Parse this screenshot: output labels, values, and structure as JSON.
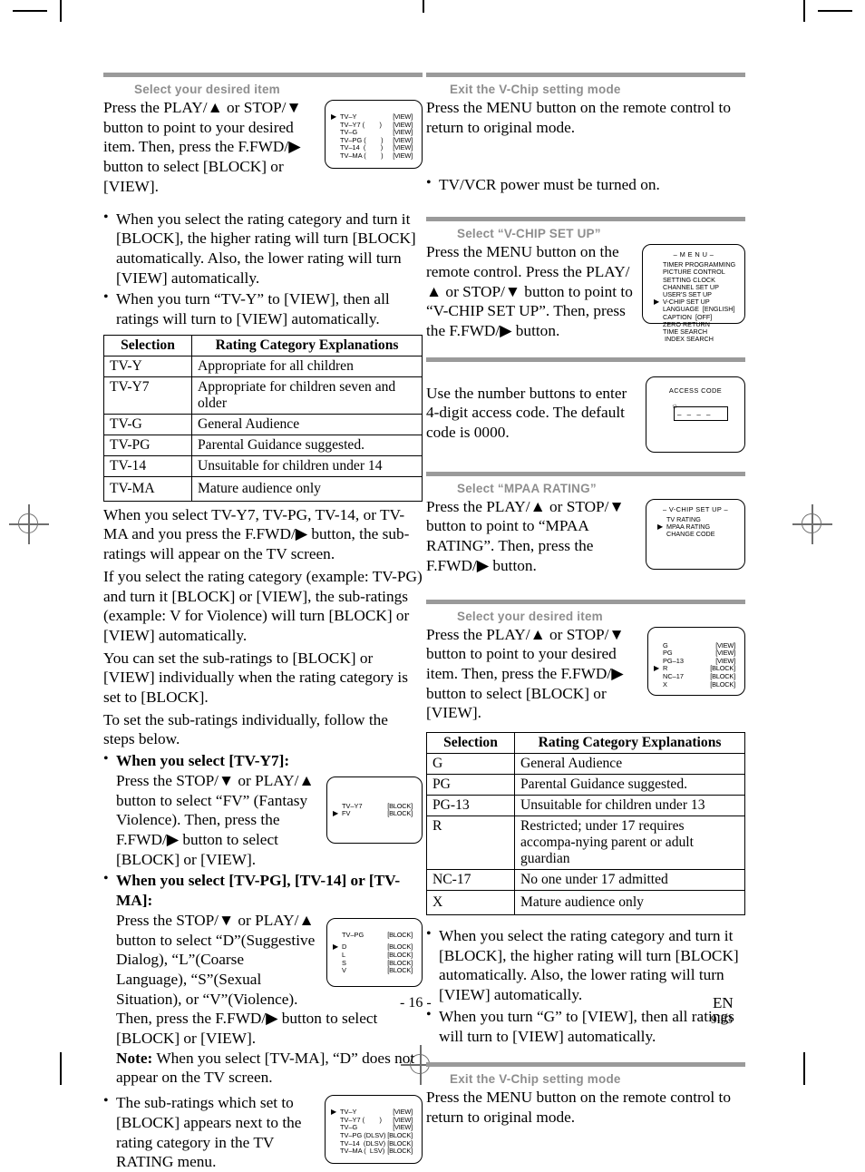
{
  "page": {
    "number_label": "- 16 -",
    "lang_code": "EN",
    "doc_code": "9I03"
  },
  "left_column": {
    "section1": {
      "title": "Select your desired item",
      "paragraph": "Press the PLAY/▲ or STOP/▼ button to point to your desired item. Then, press the F.FWD/▶ button to select [BLOCK] or [VIEW].",
      "osd": {
        "name": "tv-rating-screen",
        "cursor_index": 0,
        "rows": [
          {
            "label": "TV–Y",
            "value": "[VIEW]"
          },
          {
            "label": "TV–Y7 (        )",
            "value": "[VIEW]"
          },
          {
            "label": "TV–G",
            "value": "[VIEW]"
          },
          {
            "label": "TV–PG (        )",
            "value": "[VIEW]"
          },
          {
            "label": "TV–14  (        )",
            "value": "[VIEW]"
          },
          {
            "label": "TV–MA (        )",
            "value": "[VIEW]"
          }
        ]
      },
      "bullets": [
        "When you select the rating category and turn it [BLOCK], the higher rating will turn [BLOCK] automatically. Also, the lower rating will turn [VIEW] automatically.",
        "When you turn “TV-Y” to [VIEW], then all ratings will turn to [VIEW] automatically."
      ]
    },
    "tv_table": {
      "headers": [
        "Selection",
        "Rating Category Explanations"
      ],
      "rows": [
        [
          "TV-Y",
          "Appropriate for all children"
        ],
        [
          "TV-Y7",
          "Appropriate for children seven and older"
        ],
        [
          "TV-G",
          "General Audience"
        ],
        [
          "TV-PG",
          "Parental Guidance suggested."
        ],
        [
          "TV-14",
          "Unsuitable for children under 14"
        ],
        [
          "TV-MA",
          "Mature audience only"
        ]
      ]
    },
    "paragraphs": [
      "When you select TV-Y7, TV-PG, TV-14, or TV-MA and you press the F.FWD/▶ button, the sub-ratings will appear on the TV screen.",
      "If you select the rating category (example: TV-PG) and turn it [BLOCK] or [VIEW], the sub-ratings (example: V for Violence) will turn [BLOCK] or [VIEW] automatically.",
      "You can set the sub-ratings to [BLOCK] or [VIEW] individually when the rating category is set to [BLOCK].",
      "To set the sub-ratings individually, follow the steps below."
    ],
    "sub_items": [
      {
        "heading": "When you select [TV-Y7]:",
        "body": "Press the STOP/▼ or PLAY/▲ button to select “FV” (Fantasy Violence). Then, press the F.FWD/▶ button to select [BLOCK] or [VIEW].",
        "osd": {
          "name": "tv-y7-subrating-screen",
          "cursor_index": 1,
          "rows": [
            {
              "label": "TV–Y7",
              "value": "[BLOCK]"
            },
            {
              "label": "FV",
              "value": "[BLOCK]"
            }
          ]
        }
      },
      {
        "heading": "When you select [TV-PG], [TV-14] or [TV-MA]:",
        "body": "Press the STOP/▼ or PLAY/▲ button to select “D”(Suggestive Dialog), “L”(Coarse Language), “S”(Sexual Situation), or “V”(Violence). Then, press the F.FWD/▶ button to select [BLOCK] or [VIEW].",
        "note_label": "Note:",
        "note": " When you select [TV-MA], “D” does not appear on the TV screen.",
        "osd": {
          "name": "tv-pg-subrating-screen",
          "cursor_index": 1,
          "rows": [
            {
              "label": "TV–PG",
              "value": "[BLOCK]"
            },
            {
              "label": "D",
              "value": "[BLOCK]"
            },
            {
              "label": "L",
              "value": "[BLOCK]"
            },
            {
              "label": "S",
              "value": "[BLOCK]"
            },
            {
              "label": "V",
              "value": "[BLOCK]"
            }
          ]
        }
      }
    ],
    "last_bullet": {
      "text": "The sub-ratings which set to [BLOCK] appears next to the rating category in the TV RATING menu.",
      "osd": {
        "name": "tv-rating-with-subratings-screen",
        "cursor_index": 0,
        "rows": [
          {
            "label": "TV–Y",
            "value": "[VIEW]"
          },
          {
            "label": "TV–Y7 (        )",
            "value": "[VIEW]"
          },
          {
            "label": "TV–G",
            "value": "[VIEW]"
          },
          {
            "label": "TV–PG (DLSV)",
            "value": "[BLOCK]"
          },
          {
            "label": "TV–14  (DLSV)",
            "value": "[BLOCK]"
          },
          {
            "label": "TV–MA (  LSV)",
            "value": "[BLOCK]"
          }
        ]
      }
    }
  },
  "right_column": {
    "exit_top": {
      "title": "Exit the V-Chip setting mode",
      "paragraph": "Press the MENU button on the remote control to return to original mode.",
      "bullet": "TV/VCR power must be turned on."
    },
    "vchip_setup": {
      "title": "Select “V-CHIP SET UP”",
      "paragraph": "Press the MENU button on the remote control. Press the PLAY/▲ or STOP/▼ button to point to “V-CHIP SET UP”. Then, press the F.FWD/▶ button.",
      "osd": {
        "name": "menu-screen",
        "title": "– M E N U –",
        "cursor_index": 5,
        "items": [
          "TIMER PROGRAMMING",
          "PICTURE CONTROL",
          "SETTING CLOCK",
          "CHANNEL SET UP",
          "USER'S SET UP",
          "V-CHIP SET UP",
          "LANGUAGE  [ENGLISH]",
          "CAPTION  [OFF]",
          "ZERO RETURN",
          "TIME SEARCH",
          " INDEX SEARCH"
        ]
      }
    },
    "access_code": {
      "paragraph": "Use the number buttons to enter 4-digit access code. The default code is 0000.",
      "osd": {
        "name": "access-code-screen",
        "title": "ACCESS CODE",
        "field_value": "– – – –"
      }
    },
    "mpaa_setup": {
      "title": "Select “MPAA RATING”",
      "paragraph": "Press the PLAY/▲ or STOP/▼ button to point to “MPAA RATING”. Then, press the F.FWD/▶ button.",
      "osd": {
        "name": "vchip-setup-screen",
        "title": "– V-CHIP SET UP –",
        "cursor_index": 1,
        "items": [
          "TV RATING",
          "MPAA RATING",
          "CHANGE CODE"
        ]
      }
    },
    "select_item": {
      "title": "Select your desired item",
      "paragraph": "Press the PLAY/▲ or STOP/▼ button to point to your desired item. Then, press the F.FWD/▶ button to select [BLOCK] or [VIEW].",
      "osd": {
        "name": "mpaa-rating-screen",
        "cursor_index": 3,
        "rows": [
          {
            "label": "G",
            "value": "[VIEW]"
          },
          {
            "label": "PG",
            "value": "[VIEW]"
          },
          {
            "label": "PG–13",
            "value": "[VIEW]"
          },
          {
            "label": "R",
            "value": "[BLOCK]"
          },
          {
            "label": "NC–17",
            "value": "[BLOCK]"
          },
          {
            "label": "X",
            "value": "[BLOCK]"
          }
        ]
      }
    },
    "mpaa_table": {
      "headers": [
        "Selection",
        "Rating Category Explanations"
      ],
      "rows": [
        [
          "G",
          "General Audience"
        ],
        [
          "PG",
          "Parental Guidance suggested."
        ],
        [
          "PG-13",
          "Unsuitable for children under 13"
        ],
        [
          "R",
          "Restricted; under 17 requires accompa-nying parent or adult guardian"
        ],
        [
          "NC-17",
          "No one under 17 admitted"
        ],
        [
          "X",
          "Mature audience only"
        ]
      ]
    },
    "bullets": [
      "When you select the rating category and turn it [BLOCK], the higher rating will turn [BLOCK] automatically.  Also, the lower rating will turn [VIEW] automatically.",
      "When you turn “G” to [VIEW], then all ratings will turn to [VIEW] automatically."
    ],
    "exit_bottom": {
      "title": "Exit the V-Chip setting mode",
      "paragraph": "Press the MENU button on the remote control to return to original mode."
    }
  }
}
